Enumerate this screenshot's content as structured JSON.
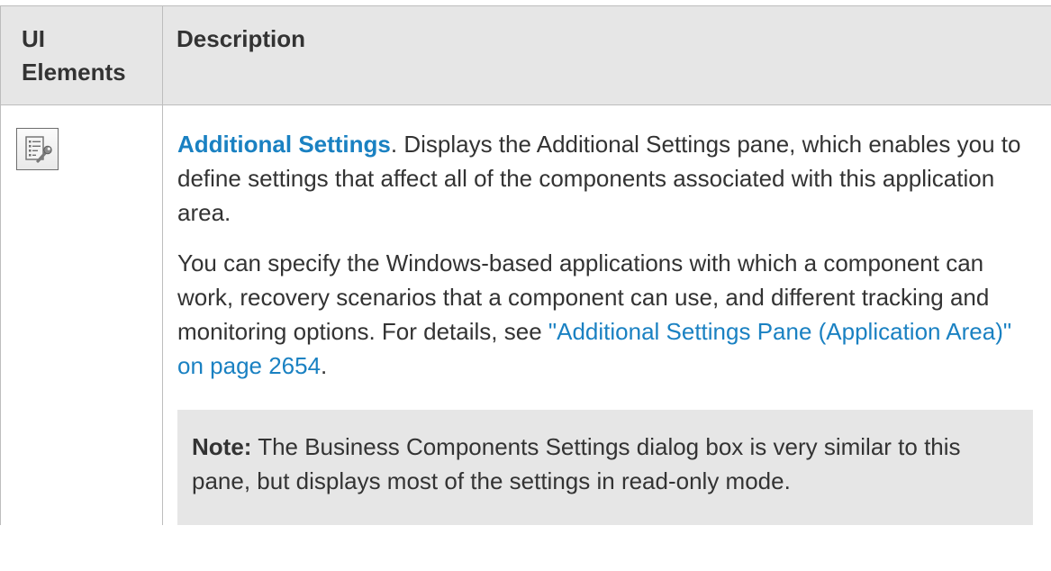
{
  "table": {
    "headers": {
      "elements": "UI Elements",
      "description": "Description"
    },
    "rows": [
      {
        "icon": "settings-list-wrench-icon",
        "term": "Additional Settings",
        "term_suffix": ". Displays the Additional Settings pane, which enables you to define settings that affect all of the components associated with this application area.",
        "para2_text": "You can specify the Windows-based applications with which a component can work, recovery scenarios that a component can use, and different tracking and monitoring options. For details, see ",
        "para2_link": "\"Additional Settings Pane (Application Area)\" on page 2654",
        "para2_end": ".",
        "note_label": "Note:",
        "note_text": " The Business Components Settings dialog box is very similar to this pane, but displays most of the settings in read-only mode."
      }
    ]
  },
  "colors": {
    "link": "#1a81c2",
    "header_bg": "#e6e6e6",
    "note_bg": "#e6e6e6",
    "border": "#bdbdbd"
  }
}
